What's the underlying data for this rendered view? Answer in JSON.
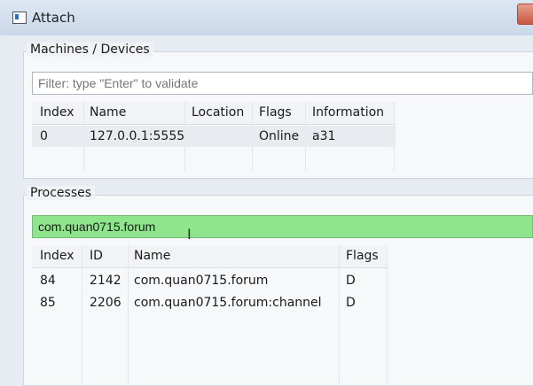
{
  "window": {
    "title": "Attach"
  },
  "machines": {
    "title": "Machines / Devices",
    "filter_placeholder": "Filter: type \"Enter\" to validate",
    "columns": [
      "Index",
      "Name",
      "Location",
      "Flags",
      "Information"
    ],
    "rows": [
      {
        "index": "0",
        "name": "127.0.0.1:5555",
        "location": "",
        "flags": "Online",
        "information": "a31"
      }
    ]
  },
  "processes": {
    "title": "Processes",
    "filter_value": "com.quan0715.forum",
    "columns": [
      "Index",
      "ID",
      "Name",
      "Flags"
    ],
    "rows": [
      {
        "index": "84",
        "id": "2142",
        "name": "com.quan0715.forum",
        "flags": "D"
      },
      {
        "index": "85",
        "id": "2206",
        "name": "com.quan0715.forum:channel",
        "flags": "D"
      }
    ]
  }
}
